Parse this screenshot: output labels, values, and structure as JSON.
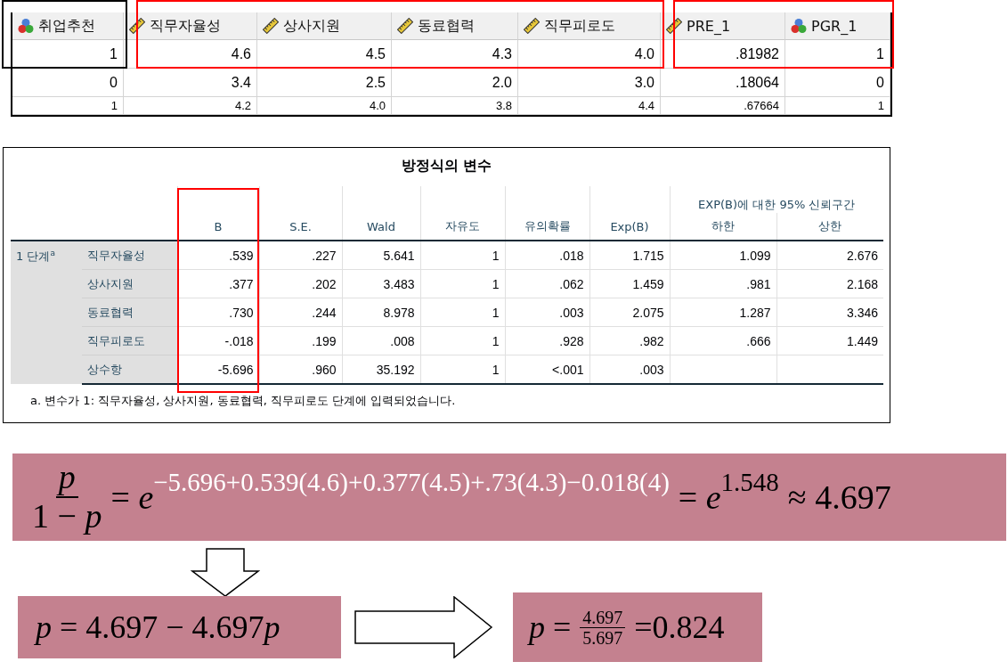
{
  "data_view": {
    "column_groups": [
      {
        "framed": true,
        "color": "#000000",
        "columns": [
          {
            "name": "취업추천",
            "kind": "nominal"
          }
        ]
      },
      {
        "framed": true,
        "color": "#ff0000",
        "columns": [
          {
            "name": "직무자율성",
            "kind": "scale"
          },
          {
            "name": "상사지원",
            "kind": "scale"
          },
          {
            "name": "동료협력",
            "kind": "scale"
          },
          {
            "name": "직무피로도",
            "kind": "scale"
          }
        ]
      },
      {
        "framed": true,
        "color": "#ff0000",
        "columns": [
          {
            "name": "PRE_1",
            "kind": "scale"
          },
          {
            "name": "PGR_1",
            "kind": "nominal"
          }
        ]
      }
    ],
    "rows": [
      [
        "1",
        "4.6",
        "4.5",
        "4.3",
        "4.0",
        ".81982",
        "1"
      ],
      [
        "0",
        "3.4",
        "2.5",
        "2.0",
        "3.0",
        ".18064",
        "0"
      ],
      [
        "1",
        "4.2",
        "4.0",
        "3.8",
        "4.4",
        ".67664",
        "1"
      ]
    ]
  },
  "output_table": {
    "title": "방정식의 변수",
    "group_header": "EXP(B)에 대한 95% 신뢰구간",
    "columns": [
      {
        "label": "B",
        "framed": true,
        "color": "#ff0000"
      },
      {
        "label": "S.E.",
        "framed": false
      },
      {
        "label": "Wald",
        "framed": false
      },
      {
        "label": "자유도",
        "framed": false
      },
      {
        "label": "유의확률",
        "framed": false
      },
      {
        "label": "Exp(B)",
        "framed": false
      },
      {
        "label": "하한",
        "framed": false
      },
      {
        "label": "상한",
        "framed": false
      }
    ],
    "step_label": "1 단계$^{a}$",
    "rows": [
      {
        "label": "직무자율성",
        "values": [
          ".539",
          ".227",
          "5.641",
          "1",
          ".018",
          "1.715",
          "1.099",
          "2.676"
        ]
      },
      {
        "label": "상사지원",
        "values": [
          ".377",
          ".202",
          "3.483",
          "1",
          ".062",
          "1.459",
          ".981",
          "2.168"
        ]
      },
      {
        "label": "동료협력",
        "values": [
          ".730",
          ".244",
          "8.978",
          "1",
          ".003",
          "2.075",
          "1.287",
          "3.346"
        ]
      },
      {
        "label": "직무피로도",
        "values": [
          "-.018",
          ".199",
          ".008",
          "1",
          ".928",
          ".982",
          ".666",
          "1.449"
        ]
      },
      {
        "label": "상수항",
        "values": [
          "-5.696",
          ".960",
          "35.192",
          "1",
          "<.001",
          ".003"
        ]
      }
    ],
    "footnote": "a. 변수가 1: 직무자율성, 상사지원, 동료협력, 직무피로도 단계에 입력되었습니다."
  },
  "equations": [
    {
      "parts": [
        {
          "kind": "frac",
          "numerator": "*p*",
          "denominator": "1 − *p*"
        },
        {
          "kind": "text",
          "text": "= *e*"
        },
        {
          "kind": "sup",
          "text": "−5.696+0.539(4.6)+0.377(4.5)+.73(4.3)−0.018(4)",
          "color": "#ffffff"
        },
        {
          "kind": "text",
          "text": "= *e*"
        },
        {
          "kind": "sup",
          "text": "1.548",
          "color": "#000000"
        },
        {
          "kind": "text",
          "text": "≈ 4.697"
        }
      ]
    },
    {
      "parts": [
        {
          "kind": "text",
          "text": "*p* = 4.697 − 4.697"
        },
        {
          "kind": "text",
          "text": "*p*"
        }
      ]
    },
    {
      "parts": [
        {
          "kind": "text",
          "text": "*p* ="
        },
        {
          "kind": "small_frac",
          "numerator": "4.697",
          "denominator": "5.697"
        },
        {
          "kind": "text",
          "text": "=0.824"
        }
      ]
    }
  ]
}
